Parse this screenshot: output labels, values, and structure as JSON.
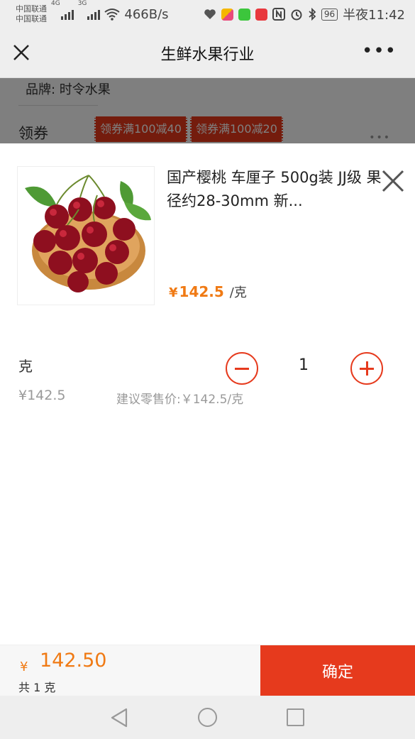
{
  "status_bar": {
    "carrier_1": "中国联通",
    "carrier_2": "中国联通",
    "net_1": "4G",
    "net_2": "3G",
    "speed": "466B/s",
    "battery": "96",
    "time": "半夜11:42",
    "icons": [
      "signal-icon",
      "wifi-icon",
      "heart-rate-icon",
      "app-icon",
      "iqiyi-icon",
      "weibo-icon",
      "nfc-icon",
      "alarm-icon",
      "bluetooth-icon",
      "battery-icon"
    ]
  },
  "nav": {
    "title": "生鲜水果行业",
    "more": "•••"
  },
  "background": {
    "brand": "品牌: 时令水果",
    "coupon_label": "领券",
    "coupons": [
      "领券满100减40",
      "领券满100减20"
    ],
    "dots": "•••"
  },
  "product": {
    "name": "国产樱桃 车厘子 500g装 JJ级 果径约28-30mm 新...",
    "price_symbol": "¥",
    "price": "142.5",
    "unit": "/克"
  },
  "spec": {
    "name": "克",
    "price": "¥142.5",
    "suggested": "建议零售价:￥142.5/克",
    "quantity": "1"
  },
  "footer": {
    "currency": "¥",
    "total": "142.50",
    "count": "共 1 克",
    "confirm": "确定"
  },
  "colors": {
    "accent": "#e63a1d",
    "price": "#f07a14"
  }
}
